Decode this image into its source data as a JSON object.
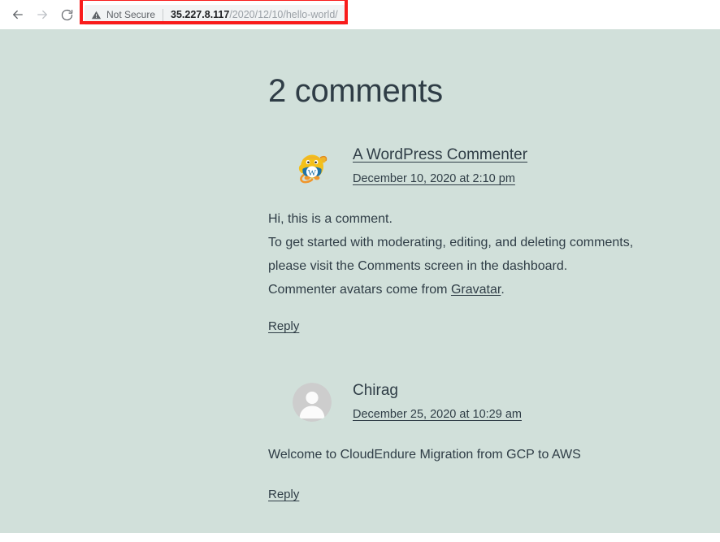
{
  "browser": {
    "back_icon": "arrow-left-icon",
    "forward_icon": "arrow-right-icon",
    "reload_icon": "reload-icon",
    "security_icon": "warning-triangle-icon",
    "security_label": "Not Secure",
    "url_host": "35.227.8.117",
    "url_path": "/2020/12/10/hello-world/",
    "url_full": "35.227.8.117/2020/12/10/hello-world/",
    "annotation_color": "#f91b1b"
  },
  "page": {
    "background_color": "#d1e0da",
    "text_color": "#2f3d46",
    "title": "2 comments",
    "comments": [
      {
        "avatar_icon": "wapuu-mascot-avatar",
        "author": "A WordPress Commenter",
        "author_is_link": true,
        "date": "December 10, 2020 at 2:10 pm",
        "body_lines": [
          "Hi, this is a comment.",
          "To get started with moderating, editing, and deleting comments,",
          "please visit the Comments screen in the dashboard.",
          "Commenter avatars come from "
        ],
        "body_link_text": "Gravatar",
        "body_tail": ".",
        "reply_label": "Reply"
      },
      {
        "avatar_icon": "default-person-avatar",
        "author": "Chirag",
        "author_is_link": false,
        "date": "December 25, 2020 at 10:29 am",
        "body_lines": [
          "Welcome to CloudEndure Migration from GCP to AWS"
        ],
        "reply_label": "Reply"
      }
    ]
  }
}
